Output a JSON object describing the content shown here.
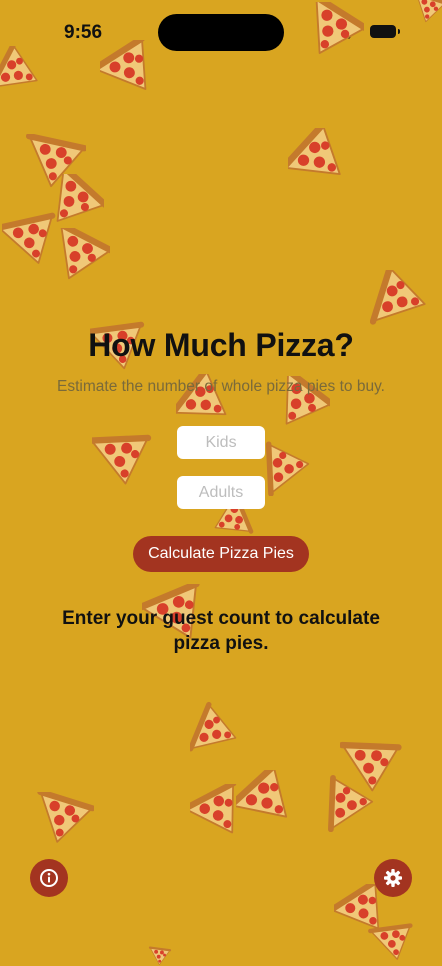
{
  "status_bar": {
    "time": "9:56"
  },
  "app": {
    "title": "How Much Pizza?",
    "subtitle": "Estimate the number of whole pizza pies to buy.",
    "kids_placeholder": "Kids",
    "adults_placeholder": "Adults",
    "calculate_label": "Calculate Pizza Pies",
    "result_text": "Enter your guest count to calculate pizza pies."
  },
  "icons": {
    "info": "info-icon",
    "settings": "gear-icon",
    "slice": "pizza-slice-icon"
  },
  "colors": {
    "background": "#D9A520",
    "accent": "#A33420",
    "crust": "#C47A2C",
    "cheese": "#F0C878",
    "pepperoni": "#D8402A"
  }
}
